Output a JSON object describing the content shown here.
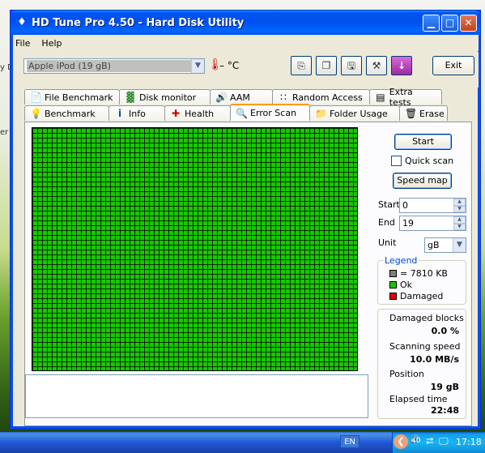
{
  "window": {
    "title": "HD Tune Pro 4.50 - Hard Disk Utility",
    "title_icon": "hdtune-app-icon",
    "controls": [
      "minimize",
      "maximize",
      "close"
    ]
  },
  "menu": {
    "file": "File",
    "help": "Help"
  },
  "toolbar": {
    "drive": "Apple   iPod          (19 gB)",
    "temperature": "– °C",
    "icons": [
      "copy-info-icon",
      "copy-screenshot-icon",
      "save-icon",
      "options-icon",
      "download-icon"
    ],
    "exit_label": "Exit"
  },
  "tabs_top": [
    {
      "label": "File Benchmark",
      "icon": "file-benchmark-icon"
    },
    {
      "label": "Disk monitor",
      "icon": "disk-monitor-icon"
    },
    {
      "label": "AAM",
      "icon": "speaker-icon"
    },
    {
      "label": "Random Access",
      "icon": "random-access-icon"
    },
    {
      "label": "Extra tests",
      "icon": "extra-tests-icon"
    }
  ],
  "tabs_bottom": [
    {
      "label": "Benchmark",
      "icon": "benchmark-icon"
    },
    {
      "label": "Info",
      "icon": "info-icon"
    },
    {
      "label": "Health",
      "icon": "health-cross-icon"
    },
    {
      "label": "Error Scan",
      "icon": "magnifier-icon",
      "active": true
    },
    {
      "label": "Folder Usage",
      "icon": "folder-icon"
    },
    {
      "label": "Erase",
      "icon": "trash-icon"
    }
  ],
  "scan": {
    "start_button": "Start",
    "quick_scan_label": "Quick scan",
    "quick_scan_checked": false,
    "speed_map_button": "Speed map",
    "start_label": "Start",
    "start_value": "0",
    "end_label": "End",
    "end_value": "19",
    "unit_label": "Unit",
    "unit_value": "gB",
    "block_state": "all-ok"
  },
  "legend": {
    "title": "Legend",
    "items": [
      {
        "label": "= 7810 KB",
        "color": "#808080"
      },
      {
        "label": "Ok",
        "color": "#19c700"
      },
      {
        "label": "Damaged",
        "color": "#e00000"
      }
    ]
  },
  "stats": {
    "damaged_blocks_label": "Damaged blocks",
    "damaged_blocks_value": "0.0 %",
    "scanning_speed_label": "Scanning speed",
    "scanning_speed_value": "10.0 MB/s",
    "position_label": "Position",
    "position_value": "19 gB",
    "elapsed_label": "Elapsed time",
    "elapsed_value": "22:48"
  },
  "taskbar": {
    "language": "EN",
    "clock": "17:18",
    "tray_text": "40"
  },
  "desktop": {
    "side_text_1": "y D",
    "side_text_2": "er"
  },
  "colors": {
    "ok_green": "#19c700",
    "damaged_red": "#e00000",
    "title_blue": "#0053ee"
  }
}
